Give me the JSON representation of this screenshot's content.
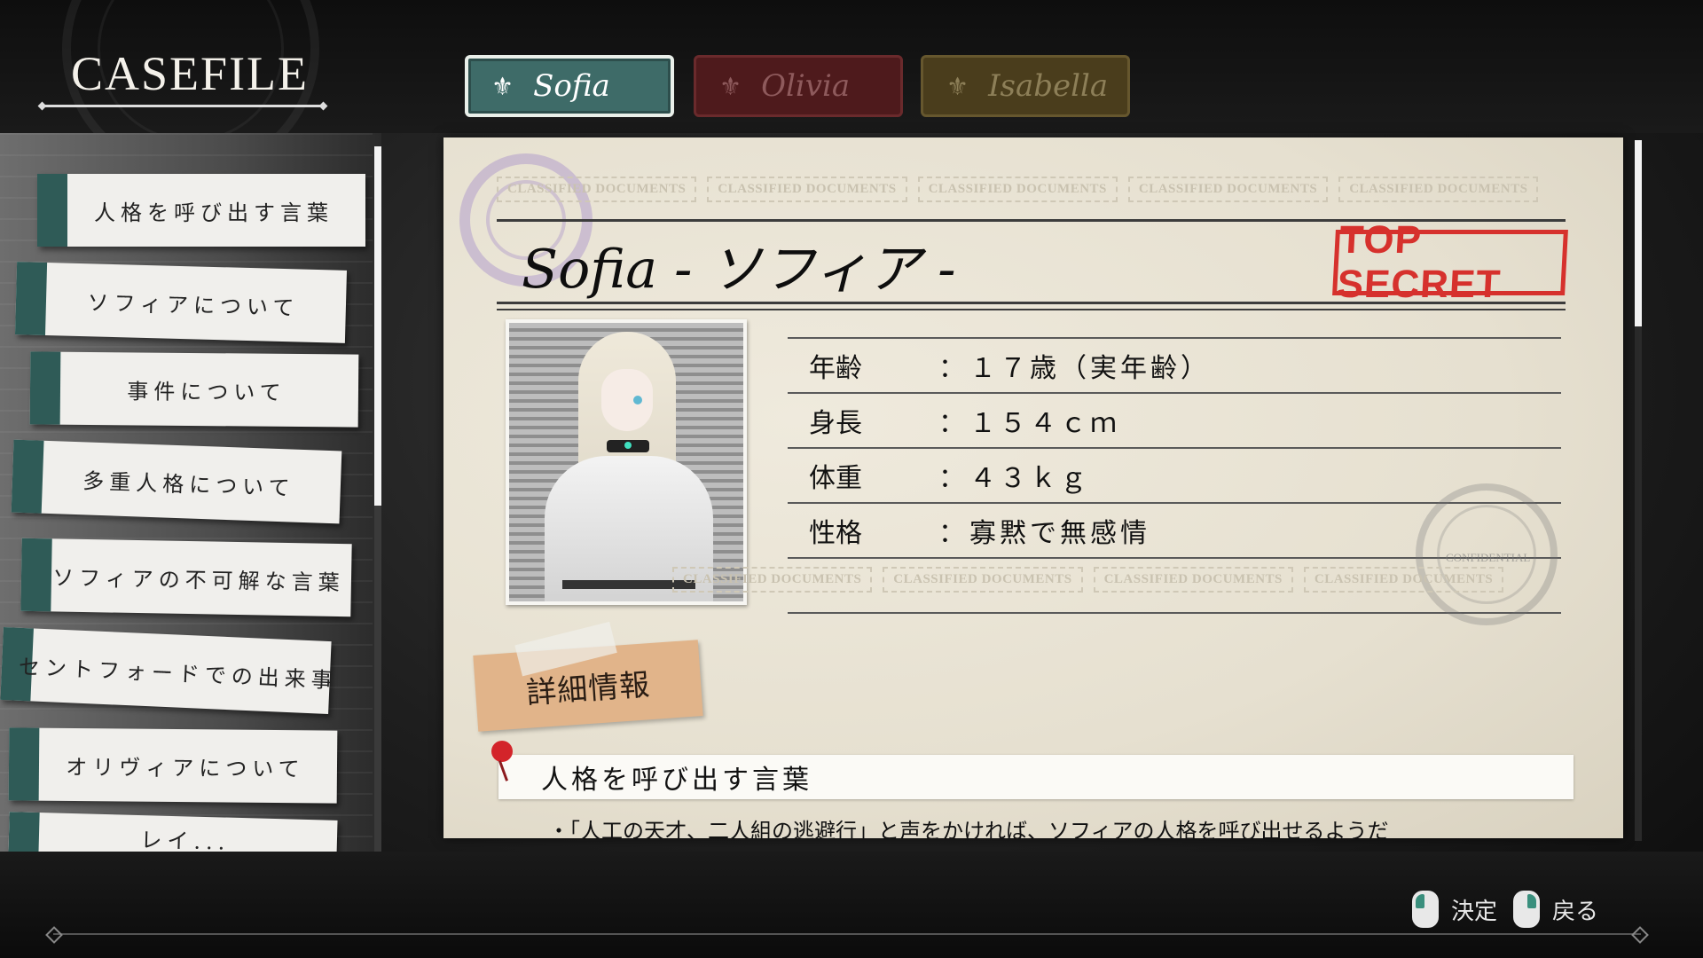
{
  "header": {
    "title": "CASEFILE"
  },
  "tabs": [
    {
      "label": "Sofia",
      "icon": "fleur-icon",
      "active": true,
      "color": "#3e6b68"
    },
    {
      "label": "Olivia",
      "icon": "fleur-icon",
      "active": false,
      "color": "#4e1a1c"
    },
    {
      "label": "Isabella",
      "icon": "fleur-icon",
      "active": false,
      "color": "#4a3d1c"
    }
  ],
  "menu": {
    "items": [
      {
        "label": "人格を呼び出す言葉"
      },
      {
        "label": "ソフィアについて"
      },
      {
        "label": "事件について"
      },
      {
        "label": "多重人格について"
      },
      {
        "label": "ソフィアの不可解な言葉"
      },
      {
        "label": "セントフォードでの出来事"
      },
      {
        "label": "オリヴィアについて"
      },
      {
        "label": "レイ..."
      }
    ]
  },
  "document": {
    "classified_label": "CLASSIFIED DOCUMENTS",
    "confidential_label": "CONFIDENTIAL",
    "name": "Sofia  - ソフィア -",
    "stamp": "TOP SECRET",
    "stamp_color": "#d6312d",
    "profile": [
      {
        "key": "年齢",
        "value": "１７歳（実年齢）"
      },
      {
        "key": "身長",
        "value": "１５４ｃｍ"
      },
      {
        "key": "体重",
        "value": "４３ｋｇ"
      },
      {
        "key": "性格",
        "value": "寡黙で無感情"
      }
    ],
    "separator": "：",
    "details_label": "詳細情報",
    "section_title": "人格を呼び出す言葉",
    "bullet": "・「人工の天才、二人組の逃避行」と声をかければ、ソフィアの人格を呼び出せるようだ"
  },
  "footer": {
    "confirm_label": "決定",
    "back_label": "戻る"
  }
}
